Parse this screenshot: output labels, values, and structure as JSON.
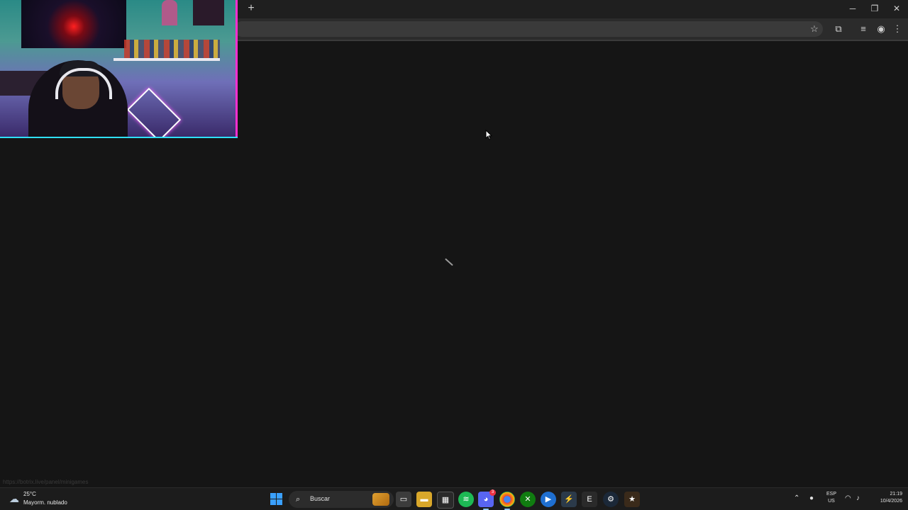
{
  "browser": {
    "new_tab_label": "+",
    "window_controls": {
      "minimize": "─",
      "restore": "❐",
      "close": "✕"
    },
    "toolbar_icons": [
      "star-icon",
      "extensions-icon",
      "media-control-icon",
      "profile-icon",
      "menu-icon"
    ],
    "status_url": "https://botrix.live/panel/minigames"
  },
  "taskbar": {
    "weather": {
      "temperature": "25°C",
      "description": "Mayorm. nublado"
    },
    "search_placeholder": "Buscar",
    "apps": [
      "file-explorer",
      "file-folder",
      "microsoft-store",
      "spotify",
      "discord",
      "chrome",
      "xbox",
      "media-player",
      "streamlabs",
      "epic-games",
      "steam",
      "app-notification"
    ],
    "discord_badge": "3",
    "language": {
      "line1": "ESP",
      "line2": "US"
    },
    "clock": {
      "time": "21:19",
      "date": "10/4/2026"
    }
  },
  "colors": {
    "page_background": "#151515",
    "webcam_border_pink": "#ff2fd0",
    "webcam_border_cyan": "#2fe0ff",
    "windows_blue": "#3aa0ff",
    "spotify_green": "#1db954",
    "discord_purple": "#5865f2"
  }
}
